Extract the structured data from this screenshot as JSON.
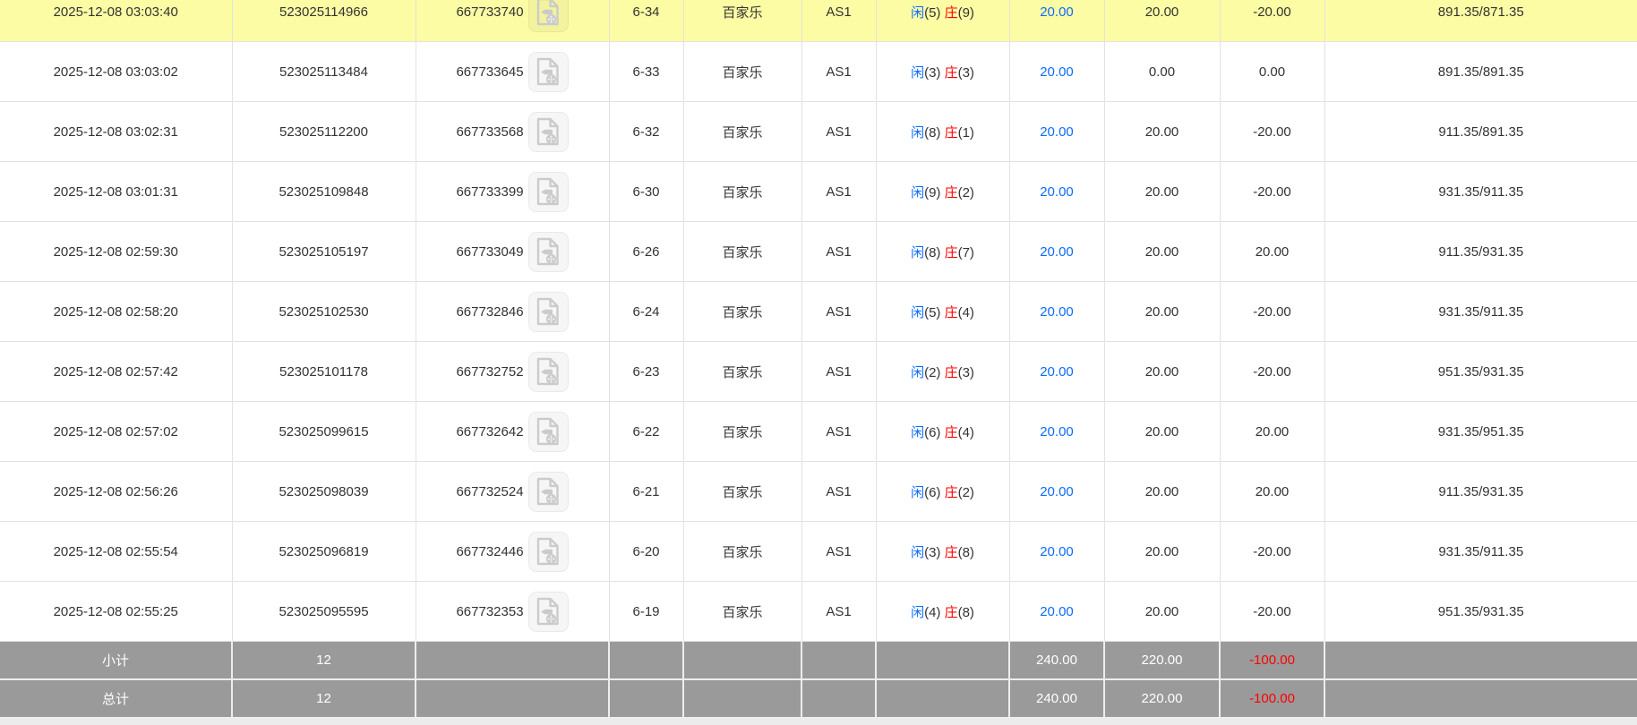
{
  "labels": {
    "player": "闲",
    "banker": "庄",
    "game_type": "百家乐",
    "table_name": "AS1",
    "video_icon": "video-replay-icon"
  },
  "colors": {
    "highlight_row": "#FCFCA4",
    "link_blue": "#0C6CFF",
    "player_blue": "#0C6CFF",
    "banker_red": "#FF0000",
    "loss_red": "#FF0000",
    "text": "#333333",
    "row_border": "#E2E2E2",
    "footer_bg": "#9A9A9A",
    "footer_text": "#FFFFFF",
    "footer_border": "#EDEDED",
    "bottom_strip": "#ECECEC"
  },
  "rows": [
    {
      "bet_time": "2025-12-08 03:03:40",
      "serial": "523025114966",
      "game_id": "667733740",
      "round": "6-34",
      "game_type": "百家乐",
      "table": "AS1",
      "player_score": "5",
      "banker_score": "9",
      "bet_amount": "20.00",
      "valid_amount": "20.00",
      "win_loss": "-20.00",
      "balance": "891.35/871.35",
      "highlighted": true
    },
    {
      "bet_time": "2025-12-08 03:03:02",
      "serial": "523025113484",
      "game_id": "667733645",
      "round": "6-33",
      "game_type": "百家乐",
      "table": "AS1",
      "player_score": "3",
      "banker_score": "3",
      "bet_amount": "20.00",
      "valid_amount": "0.00",
      "win_loss": "0.00",
      "balance": "891.35/891.35",
      "highlighted": false
    },
    {
      "bet_time": "2025-12-08 03:02:31",
      "serial": "523025112200",
      "game_id": "667733568",
      "round": "6-32",
      "game_type": "百家乐",
      "table": "AS1",
      "player_score": "8",
      "banker_score": "1",
      "bet_amount": "20.00",
      "valid_amount": "20.00",
      "win_loss": "-20.00",
      "balance": "911.35/891.35",
      "highlighted": false
    },
    {
      "bet_time": "2025-12-08 03:01:31",
      "serial": "523025109848",
      "game_id": "667733399",
      "round": "6-30",
      "game_type": "百家乐",
      "table": "AS1",
      "player_score": "9",
      "banker_score": "2",
      "bet_amount": "20.00",
      "valid_amount": "20.00",
      "win_loss": "-20.00",
      "balance": "931.35/911.35",
      "highlighted": false
    },
    {
      "bet_time": "2025-12-08 02:59:30",
      "serial": "523025105197",
      "game_id": "667733049",
      "round": "6-26",
      "game_type": "百家乐",
      "table": "AS1",
      "player_score": "8",
      "banker_score": "7",
      "bet_amount": "20.00",
      "valid_amount": "20.00",
      "win_loss": "20.00",
      "balance": "911.35/931.35",
      "highlighted": false
    },
    {
      "bet_time": "2025-12-08 02:58:20",
      "serial": "523025102530",
      "game_id": "667732846",
      "round": "6-24",
      "game_type": "百家乐",
      "table": "AS1",
      "player_score": "5",
      "banker_score": "4",
      "bet_amount": "20.00",
      "valid_amount": "20.00",
      "win_loss": "-20.00",
      "balance": "931.35/911.35",
      "highlighted": false
    },
    {
      "bet_time": "2025-12-08 02:57:42",
      "serial": "523025101178",
      "game_id": "667732752",
      "round": "6-23",
      "game_type": "百家乐",
      "table": "AS1",
      "player_score": "2",
      "banker_score": "3",
      "bet_amount": "20.00",
      "valid_amount": "20.00",
      "win_loss": "-20.00",
      "balance": "951.35/931.35",
      "highlighted": false
    },
    {
      "bet_time": "2025-12-08 02:57:02",
      "serial": "523025099615",
      "game_id": "667732642",
      "round": "6-22",
      "game_type": "百家乐",
      "table": "AS1",
      "player_score": "6",
      "banker_score": "4",
      "bet_amount": "20.00",
      "valid_amount": "20.00",
      "win_loss": "20.00",
      "balance": "931.35/951.35",
      "highlighted": false
    },
    {
      "bet_time": "2025-12-08 02:56:26",
      "serial": "523025098039",
      "game_id": "667732524",
      "round": "6-21",
      "game_type": "百家乐",
      "table": "AS1",
      "player_score": "6",
      "banker_score": "2",
      "bet_amount": "20.00",
      "valid_amount": "20.00",
      "win_loss": "20.00",
      "balance": "911.35/931.35",
      "highlighted": false
    },
    {
      "bet_time": "2025-12-08 02:55:54",
      "serial": "523025096819",
      "game_id": "667732446",
      "round": "6-20",
      "game_type": "百家乐",
      "table": "AS1",
      "player_score": "3",
      "banker_score": "8",
      "bet_amount": "20.00",
      "valid_amount": "20.00",
      "win_loss": "-20.00",
      "balance": "931.35/911.35",
      "highlighted": false
    },
    {
      "bet_time": "2025-12-08 02:55:25",
      "serial": "523025095595",
      "game_id": "667732353",
      "round": "6-19",
      "game_type": "百家乐",
      "table": "AS1",
      "player_score": "4",
      "banker_score": "8",
      "bet_amount": "20.00",
      "valid_amount": "20.00",
      "win_loss": "-20.00",
      "balance": "951.35/931.35",
      "highlighted": false
    }
  ],
  "footer": [
    {
      "label": "小计",
      "count": "12",
      "bet_amount": "240.00",
      "valid_amount": "220.00",
      "win_loss": "-100.00"
    },
    {
      "label": "总计",
      "count": "12",
      "bet_amount": "240.00",
      "valid_amount": "220.00",
      "win_loss": "-100.00"
    }
  ]
}
